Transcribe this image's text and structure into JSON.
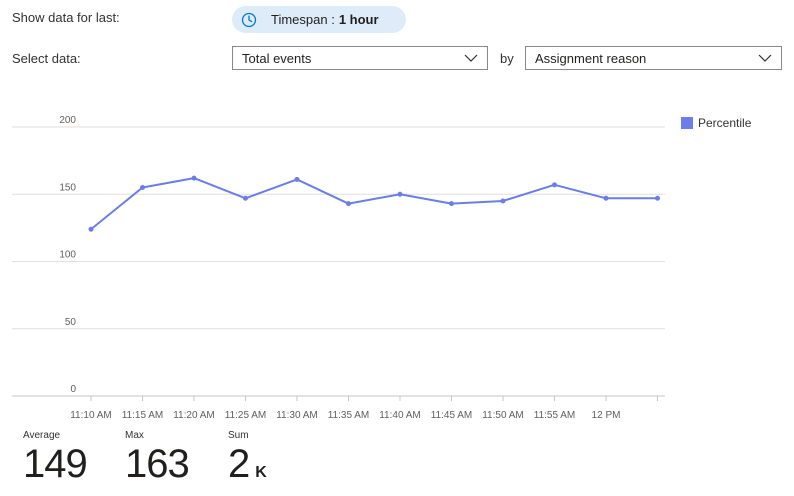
{
  "filters": {
    "timespan_label": "Show data for last:",
    "timespan_prefix": "Timespan :",
    "timespan_value": "1 hour",
    "select_label": "Select data:",
    "data_value": "Total events",
    "by_label": "by",
    "group_value": "Assignment reason"
  },
  "legend": {
    "label": "Percentile",
    "color": "#6a7de8"
  },
  "chart_data": {
    "type": "line",
    "categories": [
      "11:10 AM",
      "11:15 AM",
      "11:20 AM",
      "11:25 AM",
      "11:30 AM",
      "11:35 AM",
      "11:40 AM",
      "11:45 AM",
      "11:50 AM",
      "11:55 AM",
      "12 PM",
      ""
    ],
    "x_tick_labels": [
      "11:10 AM",
      "11:15 AM",
      "11:20 AM",
      "11:25 AM",
      "11:30 AM",
      "11:35 AM",
      "11:40 AM",
      "11:45 AM",
      "11:50 AM",
      "11:55 AM",
      "12 PM"
    ],
    "series": [
      {
        "name": "Percentile",
        "color": "#6a7de8",
        "values": [
          124,
          155,
          162,
          147,
          161,
          143,
          150,
          143,
          145,
          157,
          147,
          147
        ]
      }
    ],
    "y_ticks": [
      0,
      50,
      100,
      150,
      200
    ],
    "ylim": [
      0,
      200
    ],
    "grid": true
  },
  "summary": [
    {
      "label": "Average",
      "value": "149",
      "unit": ""
    },
    {
      "label": "Max",
      "value": "163",
      "unit": ""
    },
    {
      "label": "Sum",
      "value": "2",
      "unit": "K"
    }
  ]
}
